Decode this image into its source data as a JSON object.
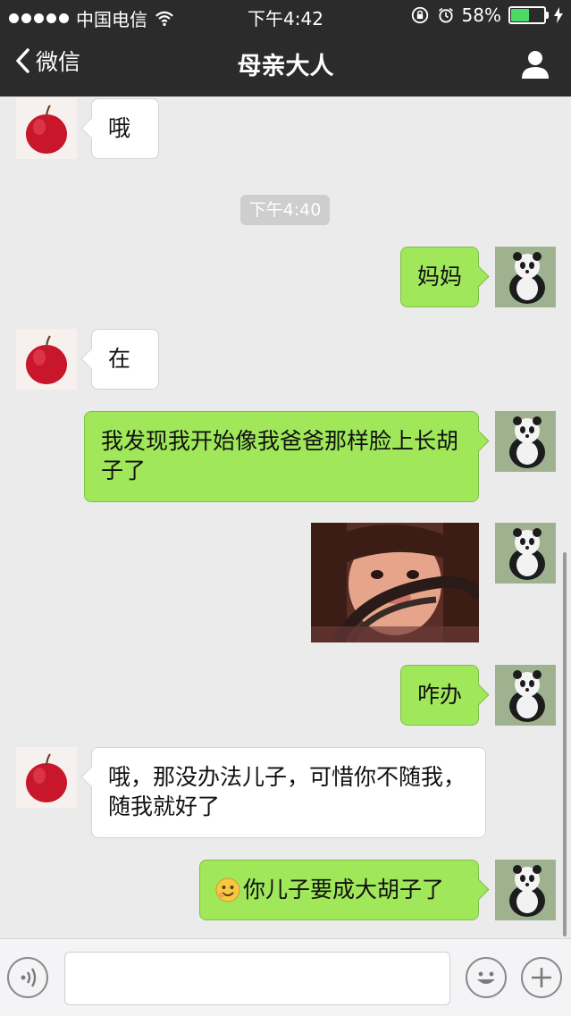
{
  "status_bar": {
    "carrier": "中国电信",
    "time": "下午4:42",
    "battery": "58%",
    "battery_level": 0.58
  },
  "nav": {
    "back_label": "微信",
    "title": "母亲大人"
  },
  "timestamp": "下午4:40",
  "messages": [
    {
      "side": "in",
      "text": "哦"
    },
    {
      "side": "out",
      "text": "妈妈"
    },
    {
      "side": "in",
      "text": "在"
    },
    {
      "side": "out",
      "text": "我发现我开始像我爸爸那样脸上长胡子了"
    },
    {
      "side": "out",
      "type": "image"
    },
    {
      "side": "out",
      "text": "咋办"
    },
    {
      "side": "in",
      "text": "哦，那没办法儿子，可惜你不随我，随我就好了"
    },
    {
      "side": "out",
      "emoji": "smile-emoji",
      "text": "你儿子要成大胡子了"
    }
  ],
  "colors": {
    "out_bubble": "#a0e75a",
    "in_bubble": "#ffffff",
    "header": "#2b2b2b",
    "background": "#ebebeb"
  },
  "toolbar": {
    "voice_icon": "voice-icon",
    "emoji_icon": "emoji-icon",
    "plus_icon": "plus-icon"
  }
}
